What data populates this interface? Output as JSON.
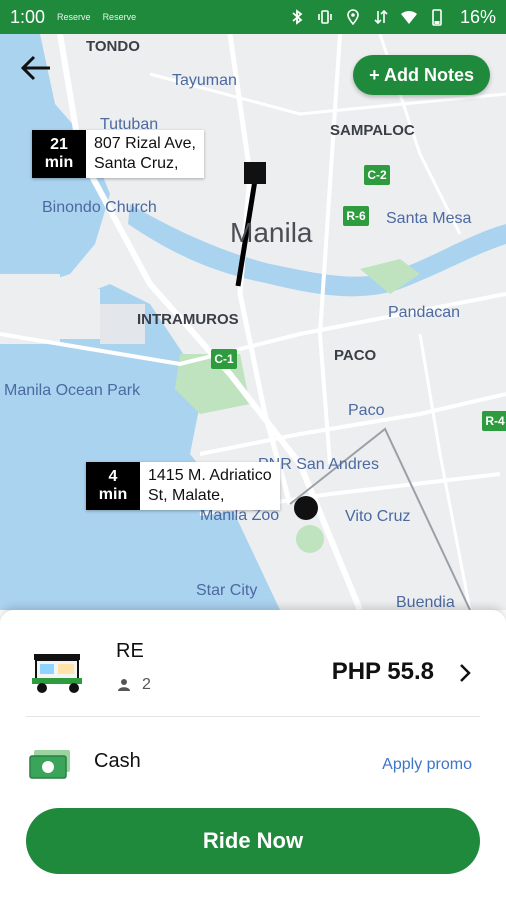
{
  "status_bar": {
    "time": "1:00",
    "notif_1": "Reserve",
    "notif_2": "Reserve",
    "battery": "16%"
  },
  "map": {
    "add_notes_label": "+ Add Notes",
    "pickup": {
      "eta_value": "21",
      "eta_unit": "min",
      "address_line1": "807 Rizal Ave,",
      "address_line2": "Santa Cruz,"
    },
    "dropoff": {
      "eta_value": "4",
      "eta_unit": "min",
      "address_line1": "1415 M. Adriatico",
      "address_line2": "St, Malate,"
    },
    "labels": {
      "tondo": "TONDO",
      "tayuman": "Tayuman",
      "tutuban": "Tutuban",
      "sampaloc": "SAMPALOC",
      "binondo": "Binondo Church",
      "manila": "Manila",
      "santa_mesa": "Santa Mesa",
      "intramuros": "INTRAMUROS",
      "pandacan": "Pandacan",
      "paco_area": "PACO",
      "ocean_park": "Manila Ocean Park",
      "paco": "Paco",
      "pnr": "PNR San Andres",
      "manila_zoo": "Manila Zoo",
      "vito_cruz": "Vito Cruz",
      "star_city": "Star City",
      "buendia": "Buendia"
    },
    "route_badges": {
      "c2": "C-2",
      "r6": "R-6",
      "c1": "C-1",
      "r4": "R-4"
    }
  },
  "ride": {
    "name": "RE",
    "passengers": "2",
    "price": "PHP 55.8"
  },
  "payment": {
    "method": "Cash",
    "promo_label": "Apply promo"
  },
  "ride_now_label": "Ride Now",
  "colors": {
    "brand_green": "#1f8a3b",
    "promo_blue": "#3f74c9",
    "water": "#aad3f0"
  }
}
